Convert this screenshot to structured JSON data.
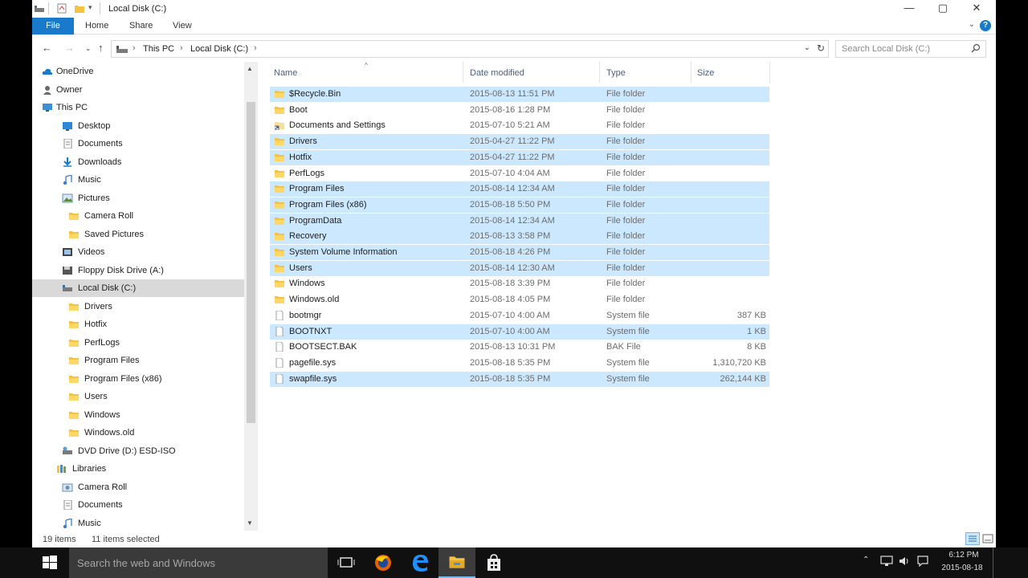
{
  "window": {
    "title": "Local Disk (C:)",
    "controls": {
      "minimize": "—",
      "maximize": "▢",
      "close": "✕"
    }
  },
  "ribbon": {
    "tabs": [
      "File",
      "Home",
      "Share",
      "View"
    ]
  },
  "address": {
    "crumbs": [
      "This PC",
      "Local Disk (C:)"
    ],
    "search_placeholder": "Search Local Disk (C:)"
  },
  "nav": {
    "items": [
      {
        "label": "OneDrive",
        "icon": "cloud-icon"
      },
      {
        "label": "Owner",
        "icon": "user-icon"
      },
      {
        "label": "This PC",
        "icon": "computer-icon"
      },
      {
        "label": "Desktop",
        "icon": "desktop-icon"
      },
      {
        "label": "Documents",
        "icon": "documents-icon"
      },
      {
        "label": "Downloads",
        "icon": "download-icon"
      },
      {
        "label": "Music",
        "icon": "music-icon"
      },
      {
        "label": "Pictures",
        "icon": "pictures-icon"
      },
      {
        "label": "Camera Roll",
        "icon": "folder-icon"
      },
      {
        "label": "Saved Pictures",
        "icon": "folder-icon"
      },
      {
        "label": "Videos",
        "icon": "video-icon"
      },
      {
        "label": "Floppy Disk Drive (A:)",
        "icon": "floppy-icon"
      },
      {
        "label": "Local Disk (C:)",
        "icon": "drive-icon"
      },
      {
        "label": "Drivers",
        "icon": "folder-icon"
      },
      {
        "label": "Hotfix",
        "icon": "folder-icon"
      },
      {
        "label": "PerfLogs",
        "icon": "folder-icon"
      },
      {
        "label": "Program Files",
        "icon": "folder-icon"
      },
      {
        "label": "Program Files (x86)",
        "icon": "folder-icon"
      },
      {
        "label": "Users",
        "icon": "folder-icon"
      },
      {
        "label": "Windows",
        "icon": "folder-icon"
      },
      {
        "label": "Windows.old",
        "icon": "folder-icon"
      },
      {
        "label": "DVD Drive (D:) ESD-ISO",
        "icon": "dvd-icon"
      },
      {
        "label": "Libraries",
        "icon": "libraries-icon"
      },
      {
        "label": "Camera Roll",
        "icon": "camera-roll-icon"
      },
      {
        "label": "Documents",
        "icon": "documents-icon"
      },
      {
        "label": "Music",
        "icon": "music-icon"
      }
    ]
  },
  "columns": {
    "name": "Name",
    "date": "Date modified",
    "type": "Type",
    "size": "Size"
  },
  "files": [
    {
      "name": "$Recycle.Bin",
      "date": "2015-08-13 11:51 PM",
      "type": "File folder",
      "size": "",
      "selected": true,
      "kind": "folder"
    },
    {
      "name": "Boot",
      "date": "2015-08-16 1:28 PM",
      "type": "File folder",
      "size": "",
      "selected": false,
      "kind": "folder"
    },
    {
      "name": "Documents and Settings",
      "date": "2015-07-10 5:21 AM",
      "type": "File folder",
      "size": "",
      "selected": false,
      "kind": "shortcut"
    },
    {
      "name": "Drivers",
      "date": "2015-04-27 11:22 PM",
      "type": "File folder",
      "size": "",
      "selected": true,
      "kind": "folder"
    },
    {
      "name": "Hotfix",
      "date": "2015-04-27 11:22 PM",
      "type": "File folder",
      "size": "",
      "selected": true,
      "kind": "folder"
    },
    {
      "name": "PerfLogs",
      "date": "2015-07-10 4:04 AM",
      "type": "File folder",
      "size": "",
      "selected": false,
      "kind": "folder"
    },
    {
      "name": "Program Files",
      "date": "2015-08-14 12:34 AM",
      "type": "File folder",
      "size": "",
      "selected": true,
      "kind": "folder"
    },
    {
      "name": "Program Files (x86)",
      "date": "2015-08-18 5:50 PM",
      "type": "File folder",
      "size": "",
      "selected": true,
      "kind": "folder"
    },
    {
      "name": "ProgramData",
      "date": "2015-08-14 12:34 AM",
      "type": "File folder",
      "size": "",
      "selected": true,
      "kind": "folder"
    },
    {
      "name": "Recovery",
      "date": "2015-08-13 3:58 PM",
      "type": "File folder",
      "size": "",
      "selected": true,
      "kind": "folder"
    },
    {
      "name": "System Volume Information",
      "date": "2015-08-18 4:26 PM",
      "type": "File folder",
      "size": "",
      "selected": true,
      "kind": "folder"
    },
    {
      "name": "Users",
      "date": "2015-08-14 12:30 AM",
      "type": "File folder",
      "size": "",
      "selected": true,
      "kind": "folder"
    },
    {
      "name": "Windows",
      "date": "2015-08-18 3:39 PM",
      "type": "File folder",
      "size": "",
      "selected": false,
      "kind": "folder"
    },
    {
      "name": "Windows.old",
      "date": "2015-08-18 4:05 PM",
      "type": "File folder",
      "size": "",
      "selected": false,
      "kind": "folder"
    },
    {
      "name": "bootmgr",
      "date": "2015-07-10 4:00 AM",
      "type": "System file",
      "size": "387 KB",
      "selected": false,
      "kind": "file"
    },
    {
      "name": "BOOTNXT",
      "date": "2015-07-10 4:00 AM",
      "type": "System file",
      "size": "1 KB",
      "selected": true,
      "kind": "file"
    },
    {
      "name": "BOOTSECT.BAK",
      "date": "2015-08-13 10:31 PM",
      "type": "BAK File",
      "size": "8 KB",
      "selected": false,
      "kind": "file"
    },
    {
      "name": "pagefile.sys",
      "date": "2015-08-18 5:35 PM",
      "type": "System file",
      "size": "1,310,720 KB",
      "selected": false,
      "kind": "file"
    },
    {
      "name": "swapfile.sys",
      "date": "2015-08-18 5:35 PM",
      "type": "System file",
      "size": "262,144 KB",
      "selected": true,
      "kind": "file"
    }
  ],
  "status": {
    "count": "19 items",
    "selected": "11 items selected"
  },
  "taskbar": {
    "search_placeholder": "Search the web and Windows",
    "time": "6:12 PM",
    "date": "2015-08-18"
  },
  "colors": {
    "selection": "#cce8ff",
    "accent": "#1979ca",
    "folder": "#f5c242",
    "taskbar": "#101010"
  }
}
